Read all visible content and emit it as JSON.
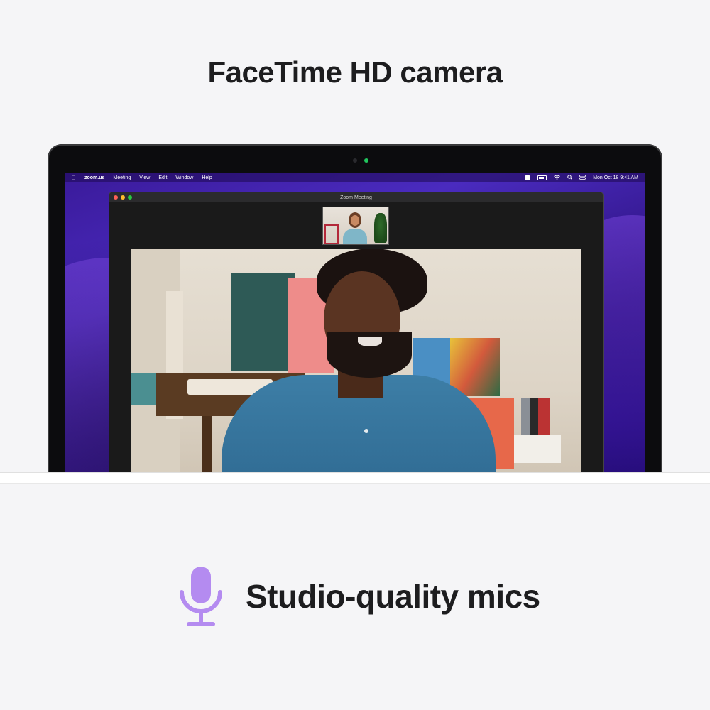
{
  "headline": "FaceTime HD camera",
  "camera_indicator_color": "#21c55d",
  "menubar": {
    "apple_icon": "apple-icon",
    "app_name": "zoom.us",
    "menus": [
      "Meeting",
      "View",
      "Edit",
      "Window",
      "Help"
    ],
    "status_icons": [
      "zoom-icon",
      "battery-icon",
      "wifi-icon",
      "search-icon",
      "control-center-icon"
    ],
    "datetime": "Mon Oct 18  9:41 AM"
  },
  "zoom_window": {
    "title": "Zoom Meeting",
    "traffic_lights": [
      "#ff5f57",
      "#febc2e",
      "#28c840"
    ]
  },
  "feature": {
    "icon": "microphone-icon",
    "icon_color": "#b48bf0",
    "label": "Studio-quality mics"
  }
}
